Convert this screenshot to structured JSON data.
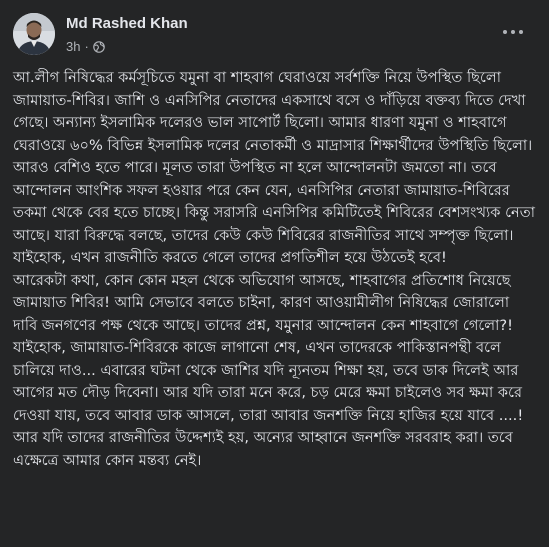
{
  "post": {
    "author": "Md Rashed Khan",
    "time": "3h",
    "separator": "·",
    "privacy_icon": "globe-icon",
    "more_icon": "more-dots-icon",
    "body": "আ.লীগ নিষিদ্ধের কর্মসূচিতে যমুনা বা শাহবাগ ঘেরাওয়ে সর্বশক্তি নিয়ে উপস্থিত ছিলো জামায়াত-শিবির। জাশি ও এনসিপির নেতাদের একসাথে বসে ও দাঁড়িয়ে বক্তব্য দিতে দেখা গেছে। অন্যান্য ইসলামিক দলেরও ভাল সাপোর্ট ছিলো। আমার ধারণা যমুনা ও শাহবাগে ঘেরাওয়ে ৬০% বিভিন্ন ইসলামিক দলের নেতাকর্মী ও মাদ্রাসার শিক্ষার্থীদের উপস্থিতি ছিলো। আরও বেশিও হতে পারে। মূলত তারা উপস্থিত না হলে আন্দোলনটা জমতো না। তবে আন্দোলন আংশিক সফল হওয়ার পরে কেন যেন, এনসিপির নেতারা জামায়াত-শিবিরের তকমা থেকে বের হতে চাচ্ছে। কিন্তু সরাসরি এনসিপির কমিটিতেই শিবিরের বেশসংখ্যক নেতা আছে। যারা বিরুদ্ধে বলছে, তাদের কেউ কেউ শিবিরের রাজনীতির সাথে সম্পৃক্ত ছিলো। যাইহোক, এখন রাজনীতি করতে গেলে   তাদের প্রগতিশীল হয়ে উঠতেই হবে!\nআরেকটা কথা, কোন কোন মহল থেকে অভিযোগ আসছে, শাহবাগের প্রতিশোধ নিয়েছে জামায়াত শিবির! আমি সেভাবে বলতে চাইনা, কারণ আওয়ামীলীগ নিষিদ্ধের জোরালো দাবি জনগণের পক্ষ থেকে আছে। তাদের প্রশ্ন, যমুনার আন্দোলন কেন শাহবাগে গেলো?! যাইহোক, জামায়াত-শিবিরকে কাজে লাগানো শেষ, এখন তাদেরকে পাকিস্তানপন্থী বলে চালিয়ে দাও... এবারের ঘটনা থেকে জাশির যদি ন্যূনতম শিক্ষা হয়, তবে ডাক দিলেই আর আগের মত দৌড় দিবেনা। আর যদি তারা মনে করে, চড় মেরে ক্ষমা চাইলেও সব ক্ষমা করে দেওয়া যায়, তবে আবার ডাক আসলে, তারা আবার জনশক্তি নিয়ে হাজির হয়ে যাবে   ....! আর যদি তাদের রাজনীতির উদ্দেশ্যই হয়, অন্যের আহ্বানে জনশক্তি সরবরাহ করা। তবে এক্ষেত্রে আমার কোন মন্তব্য নেই।"
  }
}
